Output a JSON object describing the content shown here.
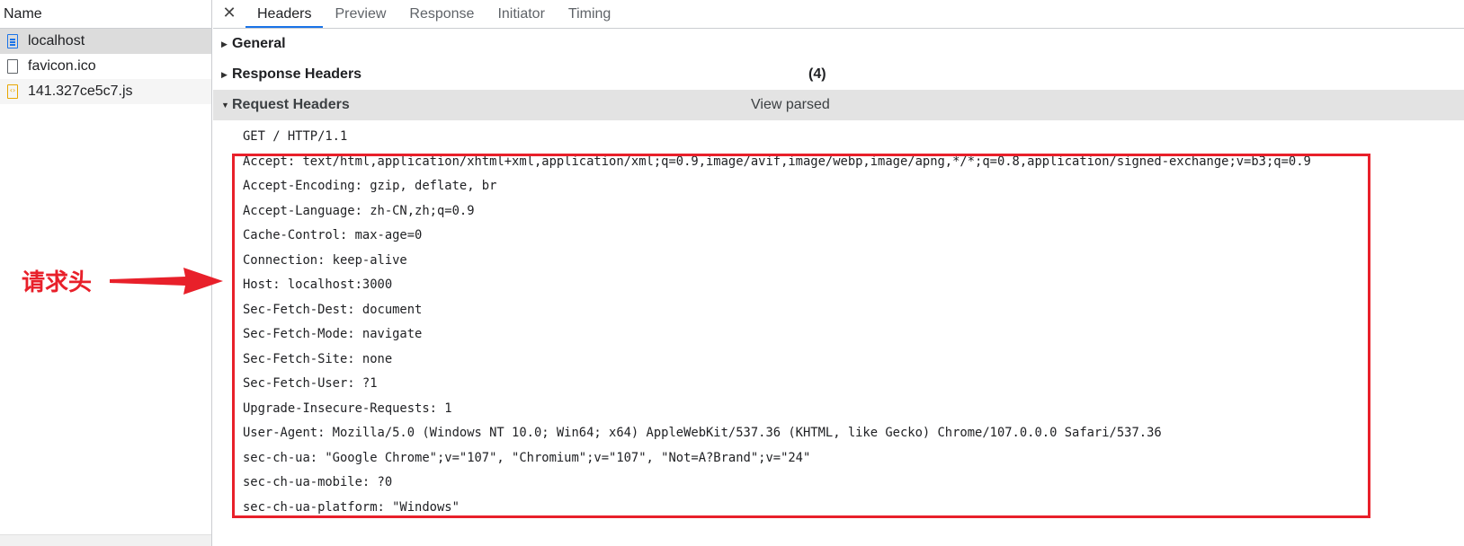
{
  "requests": {
    "header": "Name",
    "items": [
      {
        "name": "localhost",
        "icon": "document-icon"
      },
      {
        "name": "favicon.ico",
        "icon": "file-icon"
      },
      {
        "name": "141.327ce5c7.js",
        "icon": "script-icon"
      }
    ]
  },
  "tabs": {
    "close_label": "✕",
    "items": [
      "Headers",
      "Preview",
      "Response",
      "Initiator",
      "Timing"
    ],
    "active": "Headers"
  },
  "sections": {
    "general": "General",
    "response_headers": "Response Headers",
    "response_count": "(4)",
    "request_headers": "Request Headers",
    "view_parsed": "View parsed"
  },
  "request_raw": {
    "request_line": "GET / HTTP/1.1",
    "lines": [
      "Accept: text/html,application/xhtml+xml,application/xml;q=0.9,image/avif,image/webp,image/apng,*/*;q=0.8,application/signed-exchange;v=b3;q=0.9",
      "Accept-Encoding: gzip, deflate, br",
      "Accept-Language: zh-CN,zh;q=0.9",
      "Cache-Control: max-age=0",
      "Connection: keep-alive",
      "Host: localhost:3000",
      "Sec-Fetch-Dest: document",
      "Sec-Fetch-Mode: navigate",
      "Sec-Fetch-Site: none",
      "Sec-Fetch-User: ?1",
      "Upgrade-Insecure-Requests: 1",
      "User-Agent: Mozilla/5.0 (Windows NT 10.0; Win64; x64) AppleWebKit/537.36 (KHTML, like Gecko) Chrome/107.0.0.0 Safari/537.36",
      "sec-ch-ua: \"Google Chrome\";v=\"107\", \"Chromium\";v=\"107\", \"Not=A?Brand\";v=\"24\"",
      "sec-ch-ua-mobile: ?0",
      "sec-ch-ua-platform: \"Windows\""
    ]
  },
  "annotation": {
    "label": "请求头",
    "color": "#e8202a"
  },
  "colors": {
    "accent": "#1a73e8",
    "highlight": "#e8202a"
  }
}
